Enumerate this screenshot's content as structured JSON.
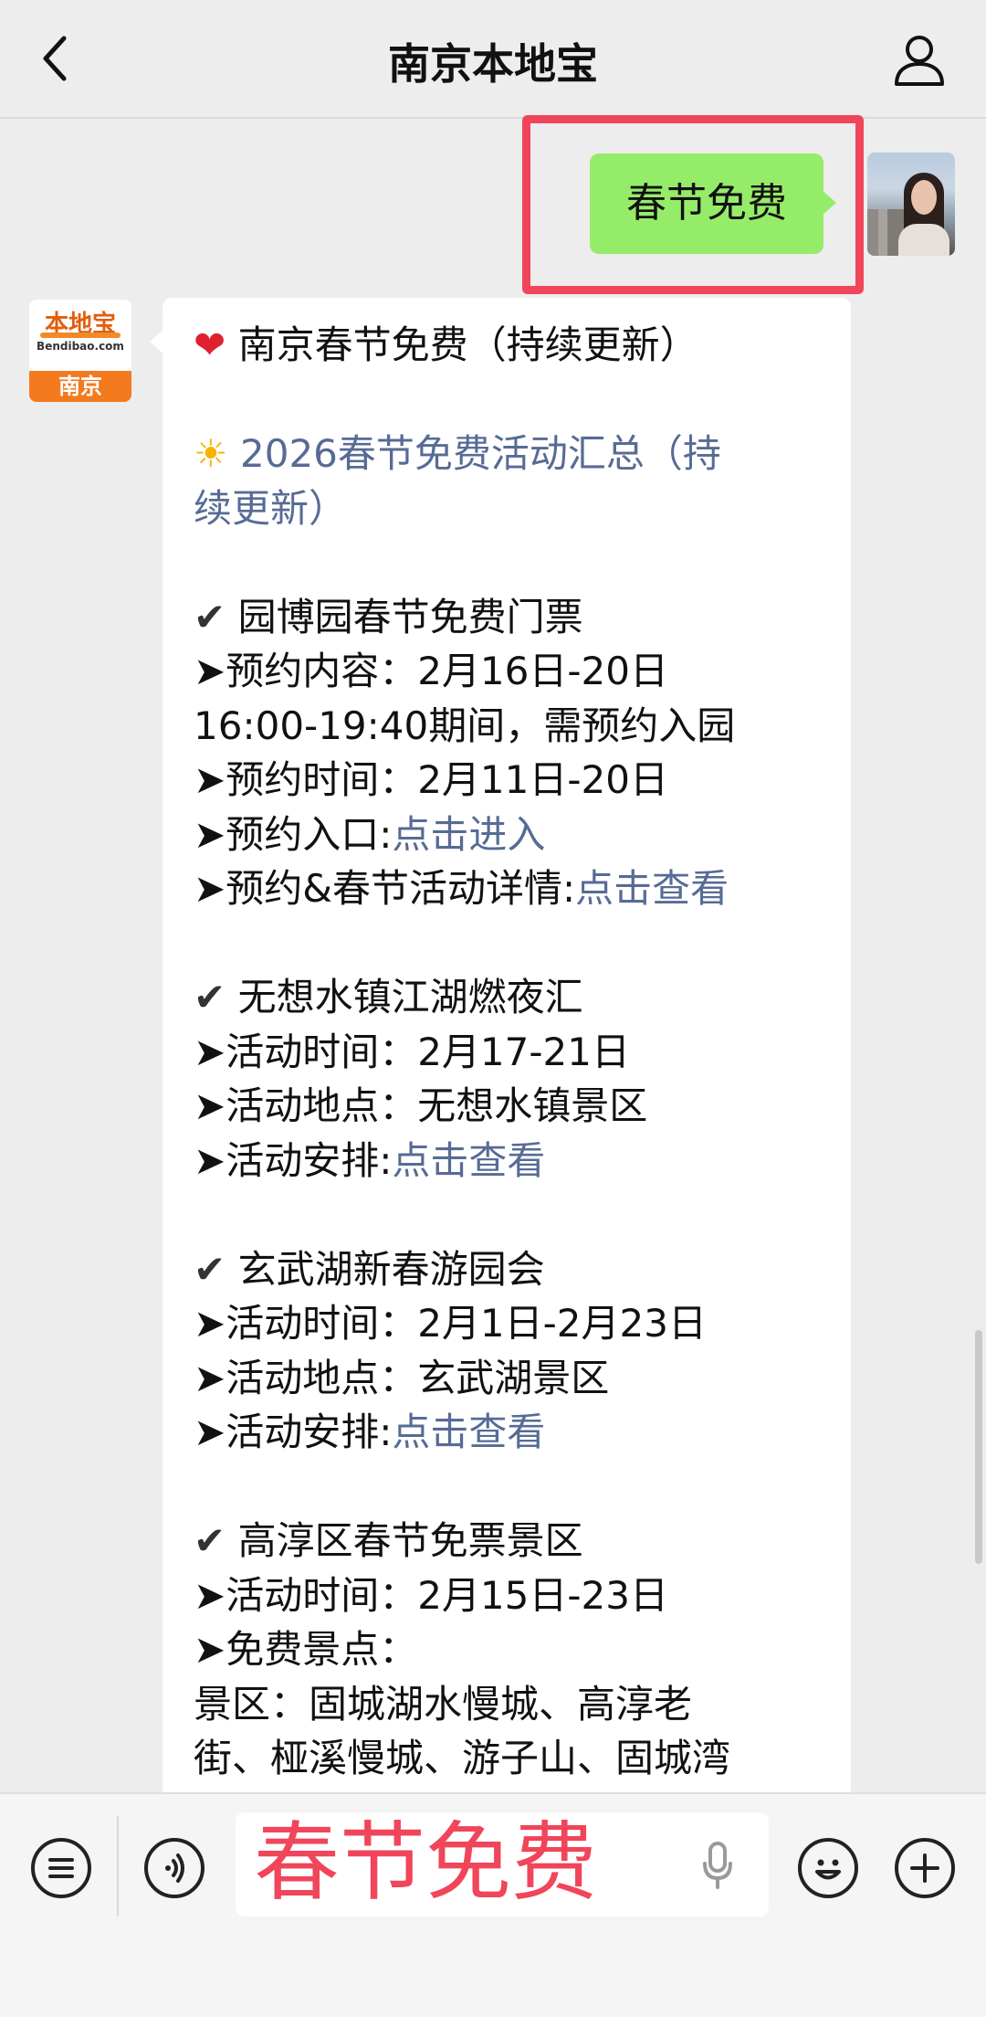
{
  "header": {
    "title": "南京本地宝",
    "back_icon": "chevron-left-icon",
    "profile_icon": "user-icon"
  },
  "outgoing": {
    "text": "春节免费",
    "highlight_color": "#f0455a",
    "bubble_color": "#95ec69"
  },
  "incoming_avatar": {
    "logo_text": "本地宝",
    "domain": "Bendibao.com",
    "city": "南京"
  },
  "message": {
    "title": "南京春节免费（持续更新）",
    "summary_link_1": "2026春节免费活动汇总（持",
    "summary_link_2": "续更新）",
    "sections": [
      {
        "heading": "园博园春节免费门票",
        "lines": [
          {
            "label": "➤预约内容：",
            "value": "2月16日-20日"
          },
          {
            "label": "",
            "value": "16:00-19:40期间，需预约入园"
          },
          {
            "label": "➤预约时间：",
            "value": "2月11日-20日"
          },
          {
            "label": "➤预约入口:",
            "link": "点击进入"
          },
          {
            "label": "➤预约&春节活动详情:",
            "link": "点击查看"
          }
        ]
      },
      {
        "heading": "无想水镇江湖燃夜汇",
        "lines": [
          {
            "label": "➤活动时间：",
            "value": "2月17-21日"
          },
          {
            "label": "➤活动地点：",
            "value": "无想水镇景区"
          },
          {
            "label": "➤活动安排:",
            "link": "点击查看"
          }
        ]
      },
      {
        "heading": "玄武湖新春游园会",
        "lines": [
          {
            "label": "➤活动时间：",
            "value": "2月1日-2月23日"
          },
          {
            "label": "➤活动地点：",
            "value": "玄武湖景区"
          },
          {
            "label": "➤活动安排:",
            "link": "点击查看"
          }
        ]
      },
      {
        "heading": "高淳区春节免票景区",
        "lines": [
          {
            "label": "➤活动时间：",
            "value": "2月15日-23日"
          },
          {
            "label": "➤免费景点：",
            "value": ""
          },
          {
            "label": "",
            "value": "景区：固城湖水慢城、高淳老"
          },
          {
            "label": "",
            "value": "街、桠溪慢城、游子山、固城湾"
          }
        ]
      }
    ]
  },
  "input": {
    "text": "春节免费",
    "text_color": "#f0455a"
  },
  "link_color": "#576b95"
}
